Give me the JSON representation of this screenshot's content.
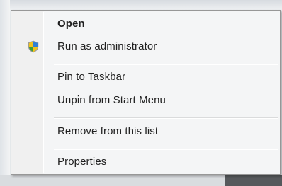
{
  "context_menu": {
    "items": [
      {
        "label": "Open",
        "bold": true
      },
      {
        "label": "Run as administrator",
        "icon": "uac-shield-icon"
      },
      {
        "label": "Pin to Taskbar"
      },
      {
        "label": "Unpin from Start Menu"
      },
      {
        "label": "Remove from this list"
      },
      {
        "label": "Properties"
      }
    ]
  }
}
